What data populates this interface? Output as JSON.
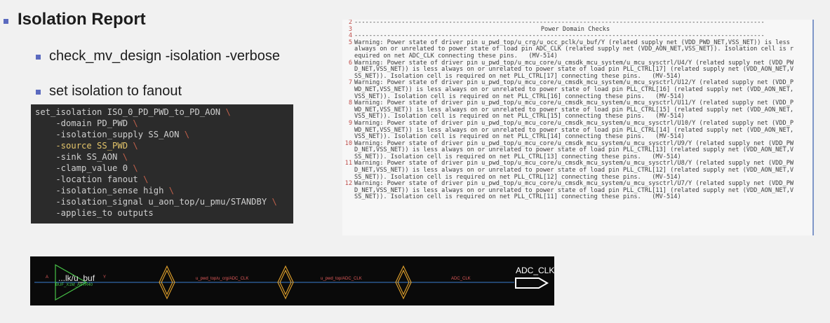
{
  "slide": {
    "title": "Isolation Report",
    "bullets": [
      "check_mv_design -isolation -verbose",
      "set isolation to fanout"
    ]
  },
  "code_lines": [
    "set_isolation ISO_0_PD_PWD_to_PD_AON ",
    "    -domain PD_PWD ",
    "    -isolation_supply SS_AON ",
    "    -source SS_PWD ",
    "    -sink SS_AON ",
    "    -clamp_value 0 ",
    "    -location fanout ",
    "    -isolation_sense high ",
    "    -isolation_signal u_aon_top/u_pmu/STANDBY ",
    "    -applies_to outputs"
  ],
  "report": {
    "separator": "--------------------------------------------------------------------------------------------------------------------------------------------------",
    "heading": "Power Domain Checks",
    "rows": [
      {
        "n": "2",
        "t": "-----------------------------------------------------------------------------------------------------------------"
      },
      {
        "n": "3",
        "heading": true
      },
      {
        "n": "4",
        "t": "-----------------------------------------------------------------------------------------------------------------"
      },
      {
        "n": "5",
        "t": "Warning: Power state of driver pin u_pwd_top/u_crg/u_occ_pclk/u_buf/Y (related supply net (VDD_PWD_NET,VSS_NET)) is less"
      },
      {
        "n": "",
        "t": "always on or unrelated to power state of load pin ADC_CLK (related supply net (VDD_AON_NET,VSS_NET)). Isolation cell is r"
      },
      {
        "n": "",
        "t": "equired on net ADC_CLK connecting these pins.   (MV-514)"
      },
      {
        "n": "6",
        "t": "Warning: Power state of driver pin u_pwd_top/u_mcu_core/u_cmsdk_mcu_system/u_mcu_sysctrl/U4/Y (related supply net (VDD_PW"
      },
      {
        "n": "",
        "t": "D_NET,VSS_NET)) is less always on or unrelated to power state of load pin PLL_CTRL[17] (related supply net (VDD_AON_NET,V"
      },
      {
        "n": "",
        "t": "SS_NET)). Isolation cell is required on net PLL_CTRL[17] connecting these pins.   (MV-514)"
      },
      {
        "n": "7",
        "t": "Warning: Power state of driver pin u_pwd_top/u_mcu_core/u_cmsdk_mcu_system/u_mcu_sysctrl/U12/Y (related supply net (VDD_P"
      },
      {
        "n": "",
        "t": "WD_NET,VSS_NET)) is less always on or unrelated to power state of load pin PLL_CTRL[16] (related supply net (VDD_AON_NET,"
      },
      {
        "n": "",
        "t": "VSS_NET)). Isolation cell is required on net PLL_CTRL[16] connecting these pins.   (MV-514)"
      },
      {
        "n": "8",
        "t": "Warning: Power state of driver pin u_pwd_top/u_mcu_core/u_cmsdk_mcu_system/u_mcu_sysctrl/U11/Y (related supply net (VDD_P"
      },
      {
        "n": "",
        "t": "WD_NET,VSS_NET)) is less always on or unrelated to power state of load pin PLL_CTRL[15] (related supply net (VDD_AON_NET,"
      },
      {
        "n": "",
        "t": "VSS_NET)). Isolation cell is required on net PLL_CTRL[15] connecting these pins.   (MV-514)"
      },
      {
        "n": "9",
        "t": "Warning: Power state of driver pin u_pwd_top/u_mcu_core/u_cmsdk_mcu_system/u_mcu_sysctrl/U10/Y (related supply net (VDD_P"
      },
      {
        "n": "",
        "t": "WD_NET,VSS_NET)) is less always on or unrelated to power state of load pin PLL_CTRL[14] (related supply net (VDD_AON_NET,"
      },
      {
        "n": "",
        "t": "VSS_NET)). Isolation cell is required on net PLL_CTRL[14] connecting these pins.   (MV-514)"
      },
      {
        "n": "10",
        "t": "Warning: Power state of driver pin u_pwd_top/u_mcu_core/u_cmsdk_mcu_system/u_mcu_sysctrl/U9/Y (related supply net (VDD_PW"
      },
      {
        "n": "",
        "t": "D_NET,VSS_NET)) is less always on or unrelated to power state of load pin PLL_CTRL[13] (related supply net (VDD_AON_NET,V"
      },
      {
        "n": "",
        "t": "SS_NET)). Isolation cell is required on net PLL_CTRL[13] connecting these pins.   (MV-514)"
      },
      {
        "n": "11",
        "t": "Warning: Power state of driver pin u_pwd_top/u_mcu_core/u_cmsdk_mcu_system/u_mcu_sysctrl/U8/Y (related supply net (VDD_PW"
      },
      {
        "n": "",
        "t": "D_NET,VSS_NET)) is less always on or unrelated to power state of load pin PLL_CTRL[12] (related supply net (VDD_AON_NET,V"
      },
      {
        "n": "",
        "t": "SS_NET)). Isolation cell is required on net PLL_CTRL[12] connecting these pins.   (MV-514)"
      },
      {
        "n": "12",
        "t": "Warning: Power state of driver pin u_pwd_top/u_mcu_core/u_cmsdk_mcu_system/u_mcu_sysctrl/U7/Y (related supply net (VDD_PW"
      },
      {
        "n": "",
        "t": "D_NET,VSS_NET)) is less always on or unrelated to power state of load pin PLL_CTRL[11] (related supply net (VDD_AON_NET,V"
      },
      {
        "n": "",
        "t": "SS_NET)). Isolation cell is required on net PLL_CTRL[11] connecting these pins.   (MV-514)"
      }
    ]
  },
  "schematic": {
    "cell_name": "...lk/u_buf",
    "cell_type": "BUF_X1M_A9TR40",
    "pin_in": "A",
    "pin_out": "Y",
    "net_labels": [
      "u_pwd_top/u_crg/ADC_CLK",
      "u_pwd_top/ADC_CLK",
      "ADC_CLK"
    ],
    "port_name": "ADC_CLK",
    "colors": {
      "background": "#0a0a0a",
      "wire": "#3a7fd0",
      "buffer": "#47c247",
      "isolation_marker": "#d79a2a",
      "label": "#e05a5a",
      "port": "#ffffff"
    }
  },
  "colors": {
    "bullet": "#5b6abf",
    "code_bg": "#2b2b2b",
    "line_number": "#c0504d"
  }
}
